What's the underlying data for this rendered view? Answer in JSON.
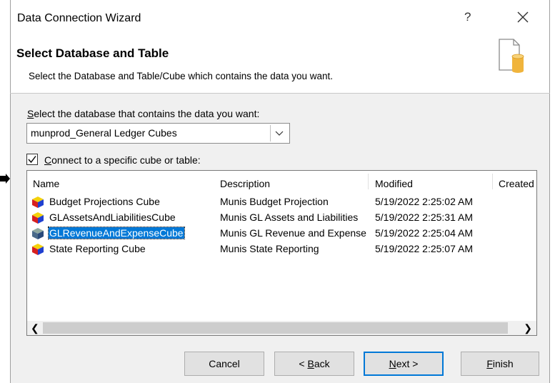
{
  "window": {
    "title": "Data Connection Wizard",
    "help": "?",
    "close": "×"
  },
  "header": {
    "title": "Select Database and Table",
    "subtitle": "Select the Database and Table/Cube which contains the data you want."
  },
  "database": {
    "label": "Select the database that contains the data you want:",
    "selected": "munprod_General Ledger Cubes"
  },
  "specific": {
    "checked": true,
    "label": "Connect to a specific cube or table:"
  },
  "table": {
    "columns": [
      "Name",
      "Description",
      "Modified",
      "Created"
    ],
    "rows": [
      {
        "name": "Budget Projections Cube",
        "description": "Munis Budget Projection",
        "modified": "5/19/2022 2:25:02 AM"
      },
      {
        "name": "GLAssetsAndLiabilitiesCube",
        "description": "Munis GL Assets and Liabilities",
        "modified": "5/19/2022 2:25:31 AM"
      },
      {
        "name": "GLRevenueAndExpenseCube",
        "description": "Munis GL Revenue and Expense",
        "modified": "5/19/2022 2:25:04 AM",
        "selected": true
      },
      {
        "name": "State Reporting Cube",
        "description": "Munis State Reporting",
        "modified": "5/19/2022 2:25:07 AM"
      }
    ]
  },
  "buttons": {
    "cancel": "Cancel",
    "back": "< Back",
    "next": "Next >",
    "finish": "Finish"
  },
  "colors": {
    "selection": "#0078d7",
    "highlight": "#ffff00"
  }
}
